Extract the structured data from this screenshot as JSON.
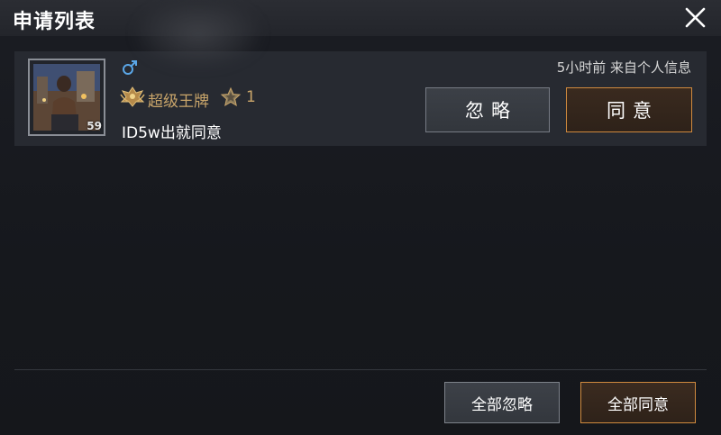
{
  "dialog": {
    "title": "申请列表"
  },
  "request": {
    "level": "59",
    "rank_name": "超级王牌",
    "rank_stars": "1",
    "message": "ID5w出就同意",
    "time_source": "5小时前 来自个人信息",
    "ignore_label": "忽略",
    "agree_label": "同意",
    "gender": "male",
    "icons": [
      "male-gender-icon",
      "rank-emblem-icon",
      "rank-star-icon"
    ]
  },
  "footer": {
    "ignore_all_label": "全部忽略",
    "agree_all_label": "全部同意"
  },
  "colors": {
    "background": "#16181d",
    "header": "#272a30",
    "card": "#272a31",
    "accent_orange": "#d08a3e",
    "rank_gold": "#c9a56a",
    "gender_blue": "#5aa6e6"
  }
}
